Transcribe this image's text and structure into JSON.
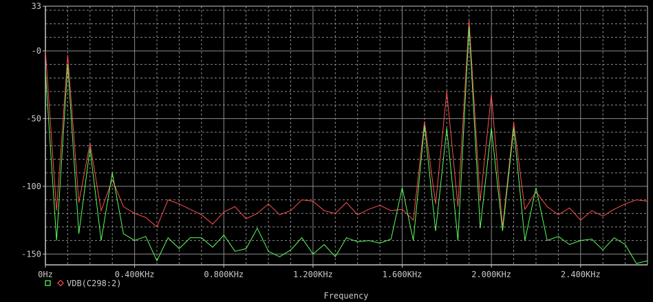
{
  "chart_data": {
    "type": "line",
    "xlabel": "Frequency",
    "x_unit_label": "KHz",
    "xlim": [
      0,
      2.7
    ],
    "ylim": [
      -158,
      33
    ],
    "x_ticks": [
      {
        "value": 0,
        "label": "0Hz"
      },
      {
        "value": 0.4,
        "label": "0.400KHz"
      },
      {
        "value": 0.8,
        "label": "0.800KHz"
      },
      {
        "value": 1.2,
        "label": "1.200KHz"
      },
      {
        "value": 1.6,
        "label": "1.600KHz"
      },
      {
        "value": 2.0,
        "label": "2.000KHz"
      },
      {
        "value": 2.4,
        "label": "2.400KHz"
      }
    ],
    "y_ticks": [
      {
        "value": 33,
        "label": "33"
      },
      {
        "value": 0,
        "label": "-0"
      },
      {
        "value": -50,
        "label": "-50"
      },
      {
        "value": -100,
        "label": "-100"
      },
      {
        "value": -150,
        "label": "-150"
      }
    ],
    "grid": true,
    "colors": {
      "background": "#000000",
      "grid_major": "#8c8c8c",
      "grid_minor": "#8c8c8c",
      "axis": "#c8c8c8",
      "red_trace": "#ff5050",
      "green_trace": "#5aff5a"
    },
    "legend": {
      "label": "VDB(C298:2)",
      "placement": "bottom-left"
    },
    "series": [
      {
        "color_key": "red_trace",
        "x": [
          0,
          0.05,
          0.1,
          0.15,
          0.2,
          0.25,
          0.3,
          0.35,
          0.4,
          0.45,
          0.5,
          0.55,
          0.6,
          0.65,
          0.7,
          0.75,
          0.8,
          0.85,
          0.9,
          0.95,
          1.0,
          1.05,
          1.1,
          1.15,
          1.2,
          1.25,
          1.3,
          1.35,
          1.4,
          1.45,
          1.5,
          1.55,
          1.6,
          1.65,
          1.7,
          1.75,
          1.8,
          1.85,
          1.9,
          1.95,
          2.0,
          2.05,
          2.1,
          2.15,
          2.2,
          2.25,
          2.3,
          2.35,
          2.4,
          2.45,
          2.5,
          2.55,
          2.6,
          2.65,
          2.7
        ],
        "y": [
          0,
          -118,
          -3,
          -112,
          -68,
          -118,
          -95,
          -115,
          -120,
          -123,
          -130,
          -110,
          -113,
          -117,
          -121,
          -128,
          -119,
          -115,
          -124,
          -120,
          -113,
          -121,
          -118,
          -110,
          -111,
          -118,
          -120,
          -112,
          -121,
          -117,
          -114,
          -118,
          -117,
          -125,
          -52,
          -113,
          -30,
          -115,
          23,
          -111,
          -32,
          -130,
          -53,
          -117,
          -104,
          -115,
          -121,
          -116,
          -125,
          -118,
          -122,
          -117,
          -113,
          -110,
          -111
        ]
      },
      {
        "color_key": "green_trace",
        "x": [
          0,
          0.05,
          0.1,
          0.15,
          0.2,
          0.25,
          0.3,
          0.35,
          0.4,
          0.45,
          0.5,
          0.55,
          0.6,
          0.65,
          0.7,
          0.75,
          0.8,
          0.85,
          0.9,
          0.95,
          1.0,
          1.05,
          1.1,
          1.15,
          1.2,
          1.25,
          1.3,
          1.35,
          1.4,
          1.45,
          1.5,
          1.55,
          1.6,
          1.65,
          1.7,
          1.75,
          1.8,
          1.85,
          1.9,
          1.95,
          2.0,
          2.05,
          2.1,
          2.15,
          2.2,
          2.25,
          2.3,
          2.35,
          2.4,
          2.45,
          2.5,
          2.55,
          2.6,
          2.65,
          2.7
        ],
        "y": [
          -15,
          -140,
          -10,
          -135,
          -72,
          -140,
          -90,
          -135,
          -140,
          -137,
          -155,
          -138,
          -146,
          -138,
          -138,
          -145,
          -136,
          -148,
          -146,
          -131,
          -148,
          -152,
          -147,
          -138,
          -150,
          -143,
          -152,
          -138,
          -141,
          -140,
          -142,
          -139,
          -101,
          -140,
          -55,
          -133,
          -57,
          -140,
          18,
          -131,
          -57,
          -133,
          -57,
          -140,
          -101,
          -140,
          -137,
          -143,
          -140,
          -139,
          -147,
          -138,
          -143,
          -157,
          -155
        ]
      }
    ]
  }
}
